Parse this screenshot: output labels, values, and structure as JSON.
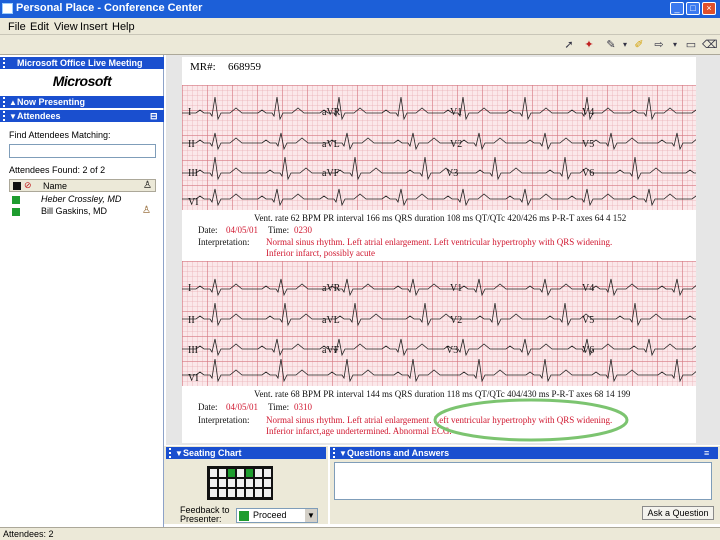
{
  "window": {
    "title": "Personal Place - Conference Center"
  },
  "menu": [
    "File",
    "Edit",
    "View",
    "Insert",
    "Help"
  ],
  "left": {
    "session_bar": "Microsoft Office Live Meeting",
    "brand": "Microsoft",
    "presenting_bar": "Now Presenting",
    "attendees_bar": "Attendees",
    "find_label": "Find Attendees Matching:",
    "found_label": "Attendees Found: 2 of 2",
    "name_header": "Name",
    "attendees": [
      {
        "name": "Heber Crossley, MD",
        "status": "#1e9c2e"
      },
      {
        "name": "Bill Gaskins, MD",
        "status": "#1e9c2e"
      }
    ]
  },
  "slide": {
    "mr_label": "MR#:",
    "mr_value": "668959",
    "leads_top": [
      "I",
      "aVR",
      "V1",
      "V4",
      "II",
      "aVL",
      "V2",
      "V5",
      "III",
      "aVF",
      "V3",
      "V6",
      "VI"
    ],
    "leads_bottom": [
      "I",
      "aVR",
      "V1",
      "V4",
      "II",
      "aVL",
      "V2",
      "V5",
      "III",
      "aVF",
      "V3",
      "V6",
      "VI"
    ],
    "ecg1": {
      "measurements": "Vent. rate 62 BPM  PR interval 166 ms  QRS duration 108 ms  QT/QTc 420/426 ms  P-R-T axes 64 4 152",
      "date_label": "Date:",
      "date": "04/05/01",
      "time_label": "Time:",
      "time": "0230",
      "interp_label": "Interpretation:",
      "interp_1": "Normal sinus rhythm.  Left atrial enlargement.  Left ventricular hypertrophy with QRS widening.",
      "interp_2": "Inferior infarct, possibly acute"
    },
    "ecg2": {
      "measurements": "Vent. rate 68 BPM  PR interval 144 ms  QRS duration 118 ms  QT/QTc 404/430 ms  P-R-T axes 68 14 199",
      "date_label": "Date:",
      "date": "04/05/01",
      "time_label": "Time:",
      "time": "0310",
      "interp_label": "Interpretation:",
      "interp_1": "Normal sinus rhythm.  Left atrial enlargement.  Left ventricular hypertrophy with QRS widening.",
      "interp_2": "Inferior infarct,age undertermined.  Abnormal ECG."
    },
    "highlight_color": "#7cc470"
  },
  "seating": {
    "bar": "Seating Chart",
    "feedback_label": "Feedback to Presenter:",
    "feedback_value": "Proceed"
  },
  "qa": {
    "bar": "Questions and Answers",
    "ask_button": "Ask a Question"
  },
  "status": {
    "attendees": "Attendees: 2"
  },
  "colors": {
    "bar_blue": "#1a4fcf",
    "title_blue": "#1c5fd8",
    "ecg_red": "#d01830"
  }
}
